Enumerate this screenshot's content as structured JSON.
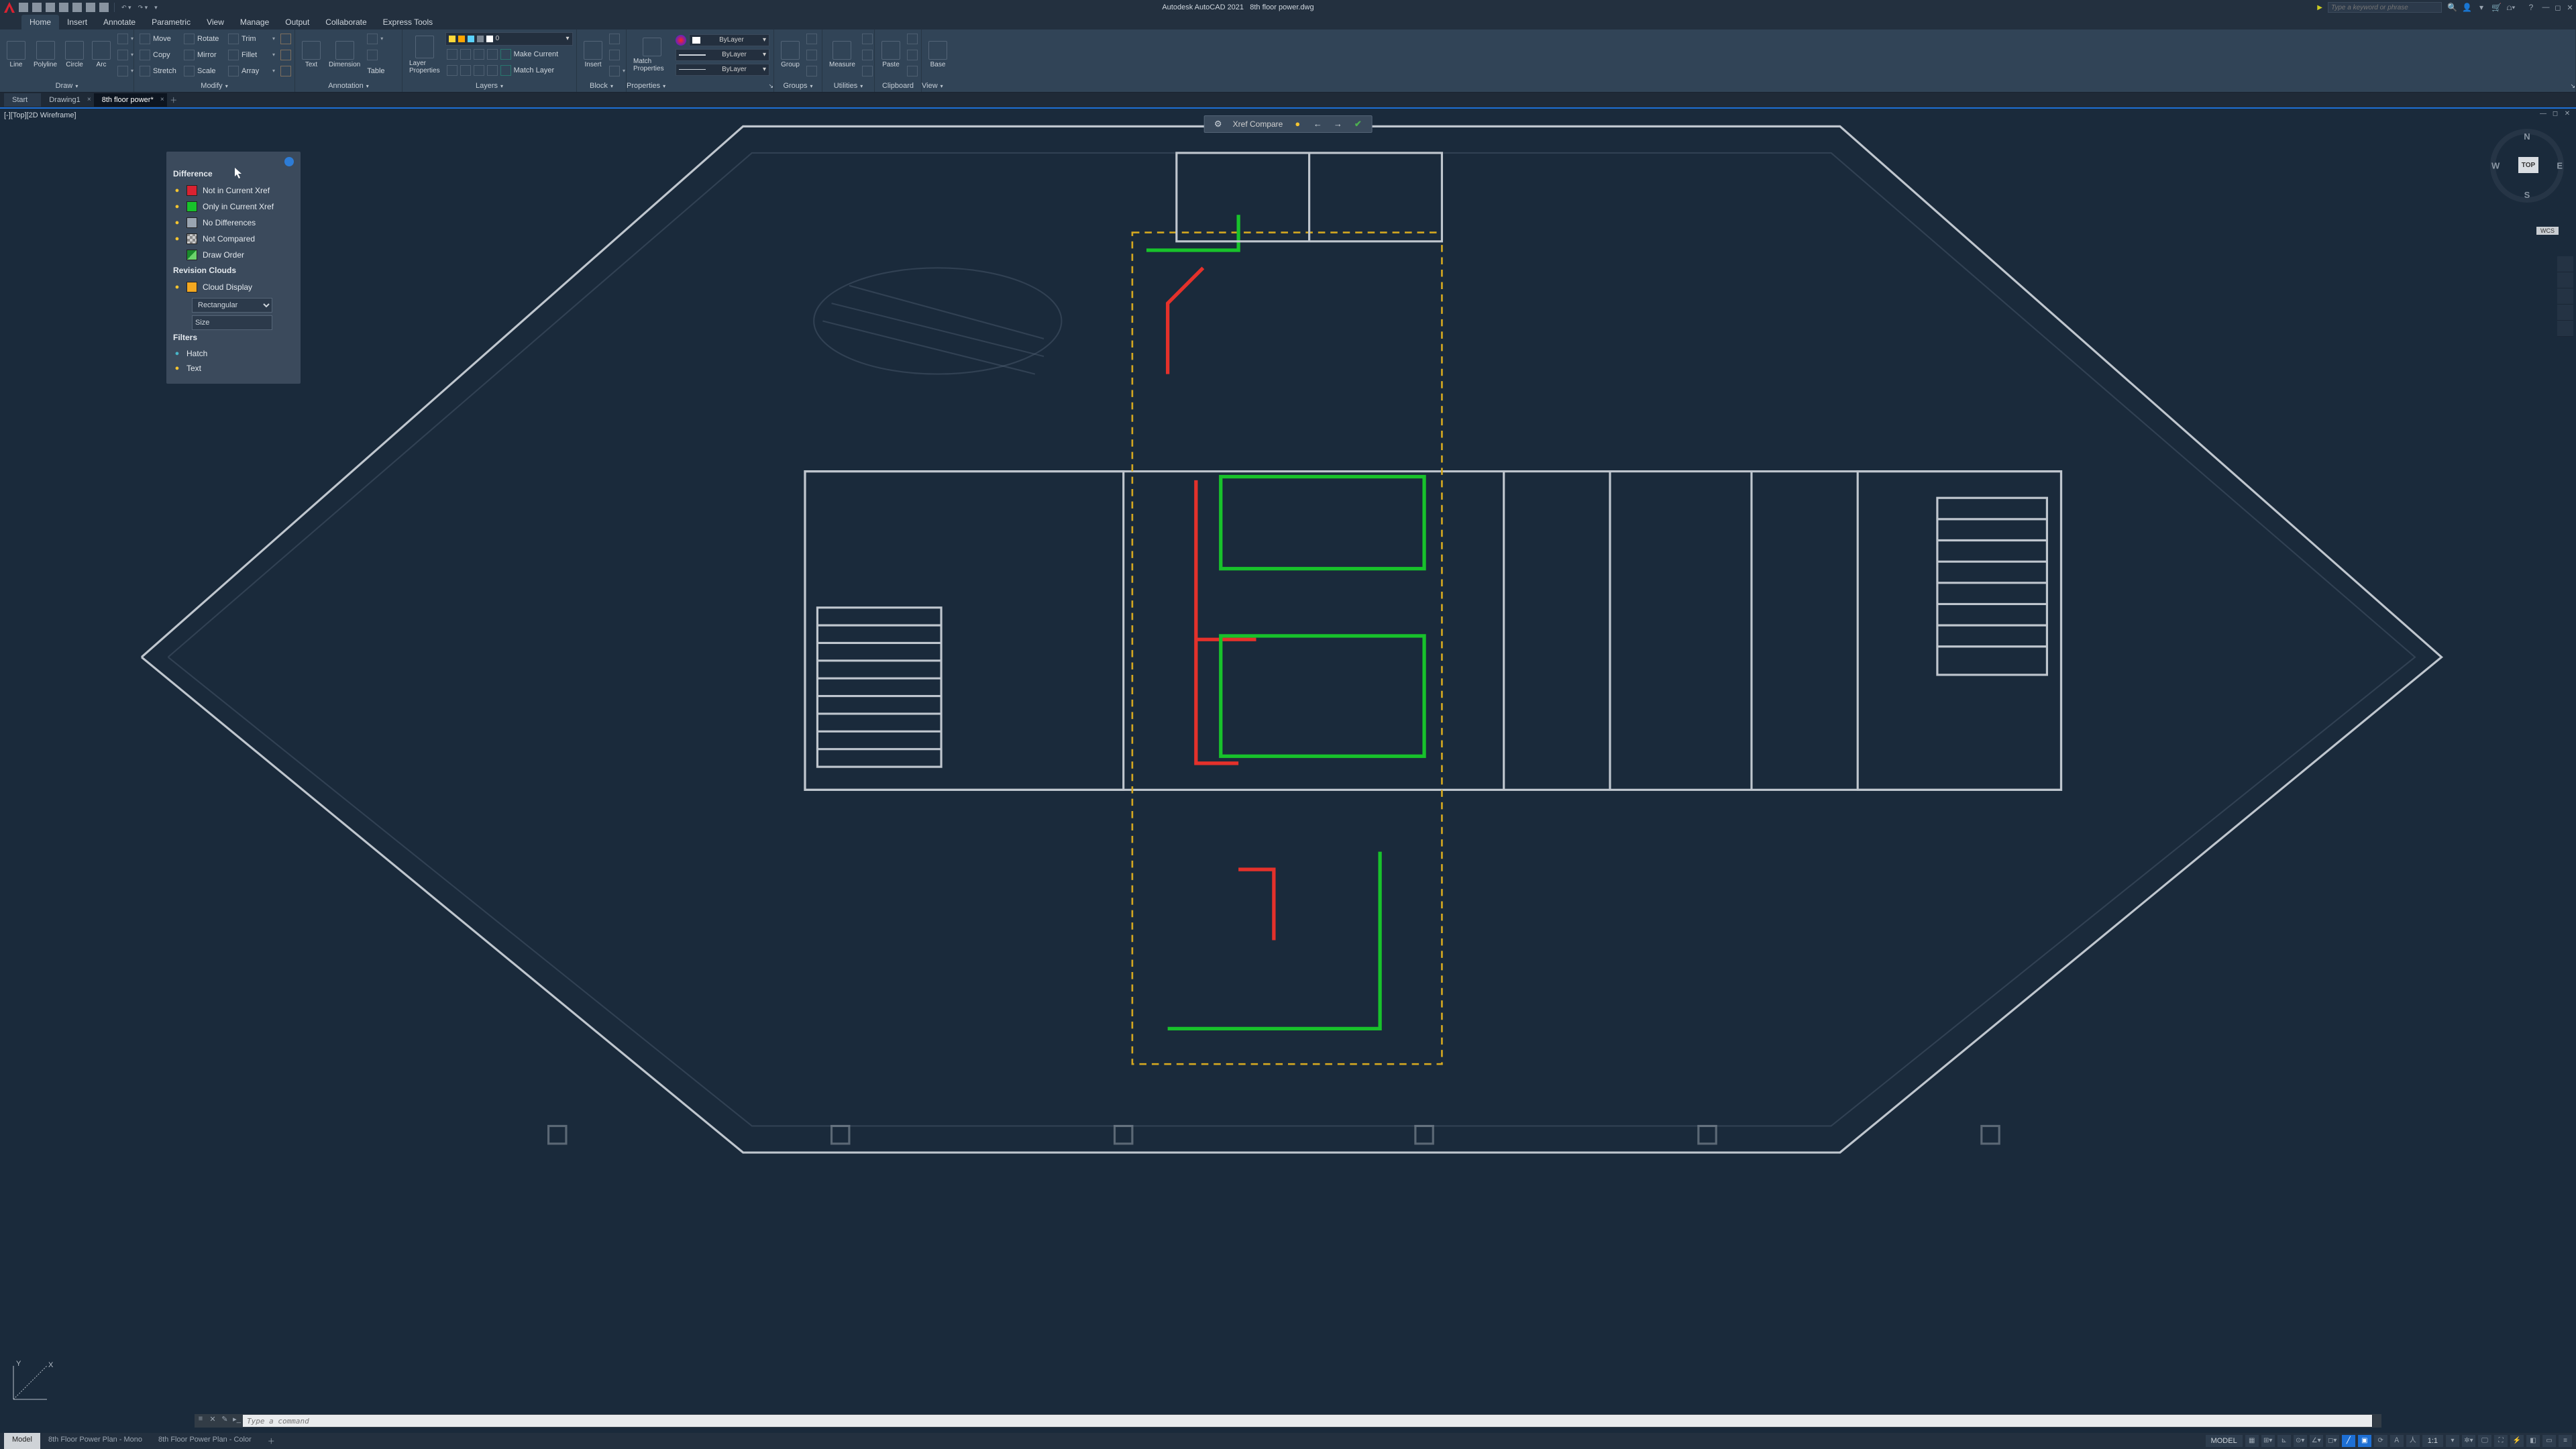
{
  "app": {
    "title": "Autodesk AutoCAD 2021",
    "file": "8th floor power.dwg"
  },
  "search": {
    "placeholder": "Type a keyword or phrase"
  },
  "menus": [
    "Home",
    "Insert",
    "Annotate",
    "Parametric",
    "View",
    "Manage",
    "Output",
    "Collaborate",
    "Express Tools"
  ],
  "menu_active": 0,
  "ribbon": {
    "draw": {
      "label": "Draw",
      "tools": [
        "Line",
        "Polyline",
        "Circle",
        "Arc"
      ]
    },
    "modify": {
      "label": "Modify",
      "rows": [
        [
          "Move",
          "Rotate",
          "Trim"
        ],
        [
          "Copy",
          "Mirror",
          "Fillet"
        ],
        [
          "Stretch",
          "Scale",
          "Array"
        ]
      ]
    },
    "annotation": {
      "label": "Annotation",
      "tools": [
        "Text",
        "Dimension",
        "Table"
      ]
    },
    "layers": {
      "label": "Layers",
      "main": "Layer Properties",
      "current": "0",
      "btns": [
        "Make Current",
        "Match Layer"
      ]
    },
    "block": {
      "label": "Block",
      "main": "Insert"
    },
    "properties": {
      "label": "Properties",
      "main": "Match Properties",
      "vals": [
        "ByLayer",
        "ByLayer",
        "ByLayer"
      ]
    },
    "groups": {
      "label": "Groups",
      "main": "Group"
    },
    "utilities": {
      "label": "Utilities",
      "main": "Measure"
    },
    "clipboard": {
      "label": "Clipboard",
      "main": "Paste"
    },
    "view": {
      "label": "View",
      "main": "Base"
    }
  },
  "filetabs": {
    "items": [
      "Start",
      "Drawing1",
      "8th floor power*"
    ],
    "active": 2
  },
  "viewport": {
    "tag": "[-][Top][2D Wireframe]"
  },
  "xref": {
    "title": "Xref Compare"
  },
  "viewcube": {
    "face": "TOP",
    "n": "N",
    "s": "S",
    "e": "E",
    "w": "W",
    "wcs": "WCS"
  },
  "palette": {
    "sec1": "Difference",
    "rows1": [
      {
        "color": "#d92231",
        "label": "Not in Current Xref"
      },
      {
        "color": "#18c22b",
        "label": "Only in Current Xref"
      },
      {
        "color": "#9aa5b1",
        "label": "No Differences"
      },
      {
        "hatch": true,
        "label": "Not Compared"
      },
      {
        "color": "#1a8a2c",
        "half": "#6bd46b",
        "label": "Draw Order",
        "nolamp": true
      }
    ],
    "sec2": "Revision Clouds",
    "cloud": {
      "color": "#f4a820",
      "label": "Cloud Display"
    },
    "shape": "Rectangular",
    "size": "Size",
    "sec3": "Filters",
    "filters": [
      {
        "label": "Hatch",
        "bulb": "off"
      },
      {
        "label": "Text",
        "bulb": "on"
      }
    ]
  },
  "cmd": {
    "placeholder": "Type a command"
  },
  "status": {
    "tabs": [
      "Model",
      "8th Floor Power Plan - Mono",
      "8th Floor Power Plan - Color"
    ],
    "active": 0,
    "model": "MODEL",
    "ratio": "1:1"
  }
}
